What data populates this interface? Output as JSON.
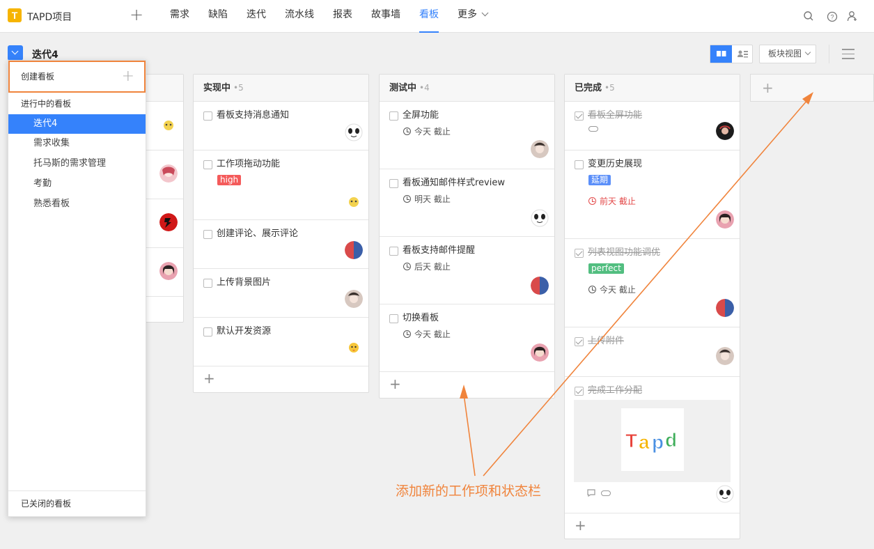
{
  "app": {
    "logo_letter": "T",
    "title": "TAPD项目"
  },
  "nav": {
    "items": [
      "需求",
      "缺陷",
      "迭代",
      "流水线",
      "报表",
      "故事墙",
      "看板",
      "更多"
    ],
    "active_index": 6
  },
  "header": {
    "iteration": "迭代4",
    "view_select": "板块视图"
  },
  "panel": {
    "create": "创建看板",
    "section": "进行中的看板",
    "items": [
      "迭代4",
      "需求收集",
      "托马斯的需求管理",
      "考勤",
      "熟悉看板"
    ],
    "active_index": 0,
    "closed": "已关闭的看板"
  },
  "columns": [
    {
      "name": "实现中",
      "count": "•5",
      "cards": [
        {
          "title": "看板支持消息通知"
        },
        {
          "title": "工作项拖动功能",
          "tag": "high"
        },
        {
          "title": "创建评论、展示评论"
        },
        {
          "title": "上传背景图片"
        },
        {
          "title": "默认开发资源"
        }
      ]
    },
    {
      "name": "测试中",
      "count": "•4",
      "cards": [
        {
          "title": "全屏功能",
          "due": "今天 截止"
        },
        {
          "title": "看板通知邮件样式review",
          "due": "明天 截止"
        },
        {
          "title": "看板支持邮件提醒",
          "due": "后天 截止"
        },
        {
          "title": "切换看板",
          "due": "今天 截止"
        }
      ]
    },
    {
      "name": "已完成",
      "count": "•5",
      "cards": [
        {
          "title": "看板全屏功能"
        },
        {
          "title": "变更历史展现",
          "tag": "延期",
          "due": "前天 截止"
        },
        {
          "title": "列表视图功能调优",
          "tag": "perfect",
          "due": "今天 截止"
        },
        {
          "title": "上传附件"
        },
        {
          "title": "完成工作分配",
          "image_text": "Tapd"
        }
      ]
    }
  ],
  "annotation": "添加新的工作项和状态栏",
  "colors": {
    "accent": "#3582fb",
    "highlight": "#f0843c",
    "tag_high": "#f45b5b",
    "tag_delay": "#5b8ff9",
    "tag_perfect": "#52be80"
  }
}
